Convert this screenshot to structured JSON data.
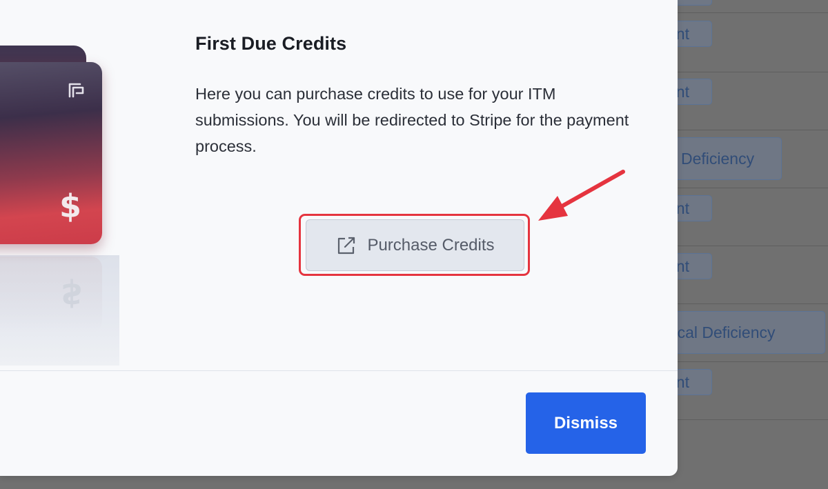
{
  "modal": {
    "title": "First Due Credits",
    "description": "Here you can purchase credits to use for your ITM submissions. You will be redirected to Stripe for the payment process.",
    "purchase_button_label": "Purchase Credits",
    "dismiss_button_label": "Dismiss",
    "card_symbol": "$",
    "primary_color": "#2563e8",
    "highlight_color": "#e5343f"
  },
  "background": {
    "badges": [
      "ant",
      "ant",
      "Deficiency",
      "ant",
      "ant",
      "itical Deficiency",
      "ant"
    ]
  }
}
